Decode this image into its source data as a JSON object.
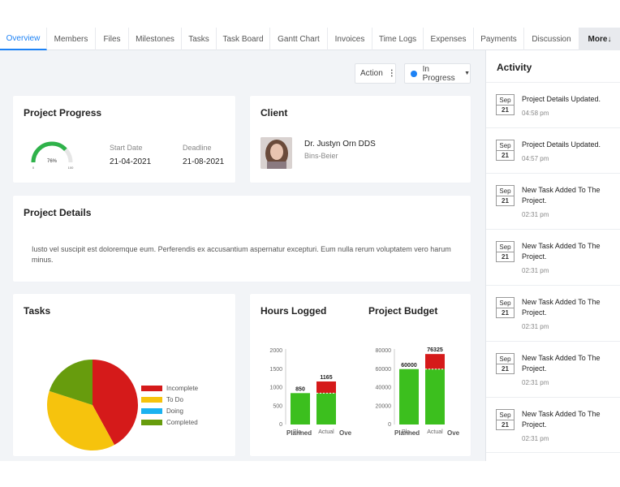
{
  "tabs": [
    {
      "label": "Overview",
      "active": true
    },
    {
      "label": "Members"
    },
    {
      "label": "Files"
    },
    {
      "label": "Milestones"
    },
    {
      "label": "Tasks"
    },
    {
      "label": "Task Board"
    },
    {
      "label": "Gantt Chart"
    },
    {
      "label": "Invoices"
    },
    {
      "label": "Time Logs"
    },
    {
      "label": "Expenses"
    },
    {
      "label": "Payments"
    },
    {
      "label": "Discussion"
    },
    {
      "label": "More↓"
    }
  ],
  "toolbar": {
    "action_label": "Action",
    "status_label": "In Progress",
    "status_color": "#1d82f5"
  },
  "progress": {
    "title": "Project Progress",
    "percent_label": "76%",
    "percent": 76,
    "gauge_min": "0",
    "gauge_max": "100",
    "start_label": "Start Date",
    "start_value": "21-04-2021",
    "deadline_label": "Deadline",
    "deadline_value": "21-08-2021"
  },
  "client": {
    "title": "Client",
    "name": "Dr. Justyn Orn DDS",
    "company": "Bins-Beier"
  },
  "details": {
    "title": "Project Details",
    "text": "Iusto vel suscipit est doloremque eum. Perferendis ex accusantium aspernatur excepturi. Eum nulla rerum voluptatem vero harum minus."
  },
  "tasks": {
    "title": "Tasks",
    "legend": [
      {
        "label": "Incomplete",
        "color": "#d51a1a"
      },
      {
        "label": "To Do",
        "color": "#f6c30d"
      },
      {
        "label": "Doing",
        "color": "#1ab2f0"
      },
      {
        "label": "Completed",
        "color": "#679c0d"
      }
    ]
  },
  "hours": {
    "title": "Hours Logged",
    "footer_left": "Planned",
    "footer_right": "Ove"
  },
  "budget": {
    "title": "Project Budget",
    "footer_left": "Planned",
    "footer_right": "Ove"
  },
  "chart_data": [
    {
      "type": "pie",
      "categories": [
        "Incomplete",
        "To Do",
        "Doing",
        "Completed"
      ],
      "values": [
        42,
        38,
        0,
        20
      ],
      "colors": [
        "#d51a1a",
        "#f6c30d",
        "#1ab2f0",
        "#679c0d"
      ]
    },
    {
      "type": "bar",
      "categories": [
        "Pla ...",
        "Actual"
      ],
      "values": [
        850,
        1165
      ],
      "value_labels": [
        "850",
        "1165"
      ],
      "overrun_base": 850,
      "yticks": [
        "2000",
        "1500",
        "1000",
        "500",
        "0"
      ],
      "ylim": [
        0,
        2000
      ]
    },
    {
      "type": "bar",
      "categories": [
        "Pla ...",
        "Actual"
      ],
      "values": [
        60000,
        76325
      ],
      "value_labels": [
        "60000",
        "76325"
      ],
      "overrun_base": 60000,
      "yticks": [
        "80000",
        "60000",
        "40000",
        "20000",
        "0"
      ],
      "ylim": [
        0,
        80000
      ]
    }
  ],
  "activity": {
    "title": "Activity",
    "items": [
      {
        "month": "Sep",
        "day": "21",
        "text": "Project Details Updated.",
        "time": "04:58 pm"
      },
      {
        "month": "Sep",
        "day": "21",
        "text": "Project Details Updated.",
        "time": "04:57 pm"
      },
      {
        "month": "Sep",
        "day": "21",
        "text": "New Task Added To The Project.",
        "time": "02:31 pm"
      },
      {
        "month": "Sep",
        "day": "21",
        "text": "New Task Added To The Project.",
        "time": "02:31 pm"
      },
      {
        "month": "Sep",
        "day": "21",
        "text": "New Task Added To The Project.",
        "time": "02:31 pm"
      },
      {
        "month": "Sep",
        "day": "21",
        "text": "New Task Added To The Project.",
        "time": "02:31 pm"
      },
      {
        "month": "Sep",
        "day": "21",
        "text": "New Task Added To The Project.",
        "time": "02:31 pm"
      }
    ]
  }
}
